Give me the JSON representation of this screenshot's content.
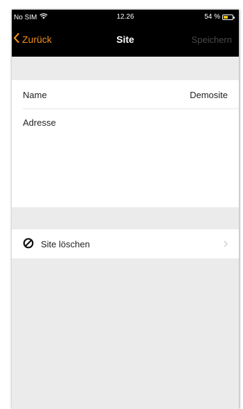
{
  "status_bar": {
    "carrier": "No SIM",
    "time": "12.26",
    "battery": "54 %",
    "battery_level": 0.54
  },
  "nav": {
    "back_label": "Zurück",
    "title": "Site",
    "save_label": "Speichern"
  },
  "form": {
    "name_label": "Name",
    "name_value": "Demosite",
    "address_label": "Adresse",
    "address_value": ""
  },
  "actions": {
    "delete_label": "Site löschen"
  },
  "colors": {
    "accent": "#f28d1a",
    "disabled": "#4a4a4a",
    "background": "#ebebeb"
  },
  "icons": {
    "back": "chevron-left-icon",
    "delete": "prohibited-icon",
    "disclosure": "chevron-right-icon",
    "wifi": "wifi-icon",
    "battery": "battery-icon"
  }
}
